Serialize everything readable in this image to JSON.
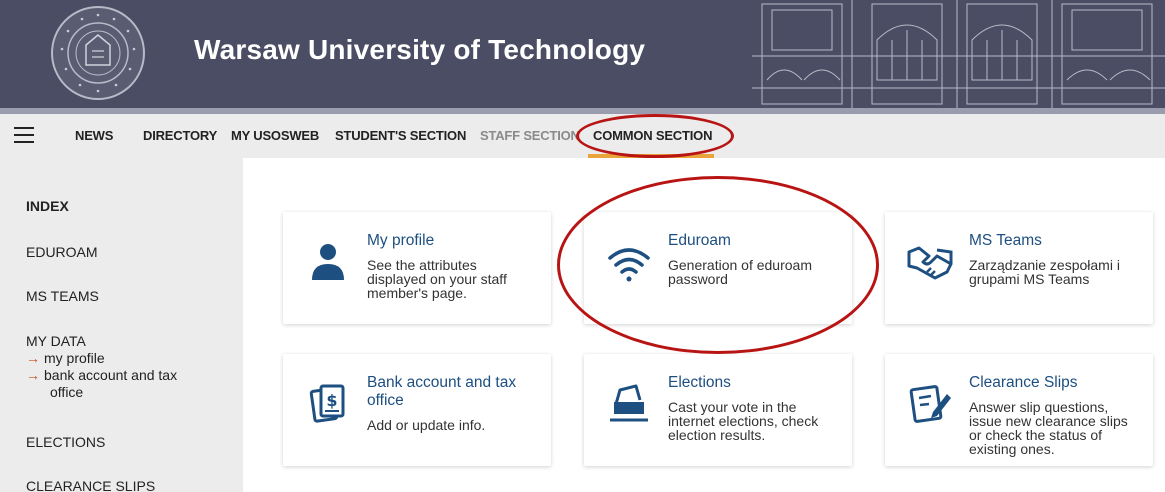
{
  "header": {
    "title": "Warsaw University of Technology",
    "seal_icon": "university-seal-icon"
  },
  "nav": {
    "items": [
      "NEWS",
      "DIRECTORY",
      "MY USOSWEB",
      "STUDENT'S SECTION",
      "STAFF SECTION",
      "COMMON SECTION"
    ],
    "active": "COMMON SECTION"
  },
  "sidebar": {
    "index": "INDEX",
    "eduroam": "EDUROAM",
    "ms_teams": "MS TEAMS",
    "my_data": "MY DATA",
    "my_profile": "my profile",
    "bank_line1": "bank account and tax",
    "bank_line2": "office",
    "elections": "ELECTIONS",
    "clearance": "CLEARANCE SLIPS"
  },
  "cards": {
    "profile": {
      "title": "My profile",
      "desc": [
        "See the attributes",
        "displayed on your staff",
        "member's page."
      ],
      "icon": "person-icon"
    },
    "eduroam": {
      "title": "Eduroam",
      "desc": [
        "Generation of eduroam",
        "password"
      ],
      "icon": "wifi-icon"
    },
    "teams": {
      "title": "MS Teams",
      "desc": [
        "Zarządzanie zespołami i",
        "grupami MS Teams"
      ],
      "icon": "handshake-icon"
    },
    "bank": {
      "title": [
        "Bank account and tax",
        "office"
      ],
      "desc": [
        "Add or update info."
      ],
      "icon": "invoice-icon"
    },
    "elections": {
      "title": "Elections",
      "desc": [
        "Cast your vote in the",
        "internet elections, check",
        "election results."
      ],
      "icon": "ballot-box-icon"
    },
    "clearance": {
      "title": "Clearance Slips",
      "desc": [
        "Answer slip questions,",
        "issue new clearance slips",
        "or check the status of",
        "existing ones."
      ],
      "icon": "signed-document-icon"
    }
  },
  "colors": {
    "banner": "#4a4d63",
    "accent": "#e9a43a",
    "link": "#1d4f80",
    "annotation": "#b81414"
  }
}
